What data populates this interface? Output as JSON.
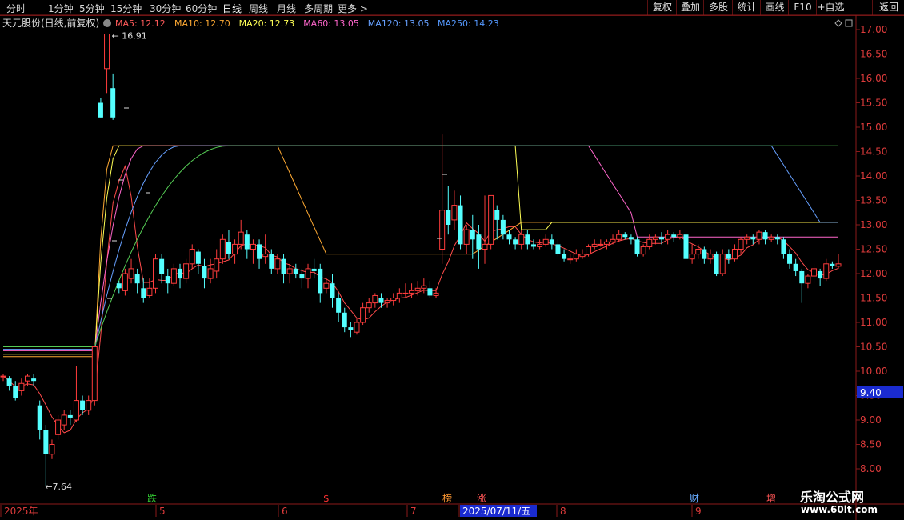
{
  "toolbar": {
    "tabs": [
      "分时",
      "1分钟",
      "5分钟",
      "15分钟",
      "30分钟",
      "60分钟",
      "日线",
      "周线",
      "月线",
      "多周期",
      "更多 >"
    ],
    "active_tab": "日线",
    "buttons": [
      "复权",
      "叠加",
      "多股",
      "统计",
      "画线",
      "F10",
      "+自选",
      "返回"
    ]
  },
  "legend": {
    "stock": "天元股份(日线,前复权)",
    "items": [
      {
        "text": "MA5: 12.12",
        "color": "#ff5a5a"
      },
      {
        "text": "MA10: 12.70",
        "color": "#ffaa33"
      },
      {
        "text": "MA20: 12.73",
        "color": "#ffff55"
      },
      {
        "text": "MA60: 13.05",
        "color": "#ff66cc"
      },
      {
        "text": "MA120: 13.05",
        "color": "#66a0ff"
      },
      {
        "text": "MA250: 14.23",
        "color": "#5599ff"
      }
    ]
  },
  "markers": [
    {
      "text": "跌",
      "color": "#33cc33"
    },
    {
      "text": "$",
      "color": "#ff3333"
    },
    {
      "text": "榜",
      "color": "#ff9933"
    },
    {
      "text": "涨",
      "color": "#ff5555"
    },
    {
      "text": "财",
      "color": "#66aaff"
    },
    {
      "text": "增",
      "color": "#ff5555"
    }
  ],
  "date_axis": [
    "2025年",
    "5",
    "6",
    "7",
    "2025/07/11/五",
    "8",
    "9"
  ],
  "price_tag": "9.40",
  "watermark": {
    "title": "乐淘公式网",
    "url": "www.60lt.com"
  },
  "colors": {
    "up": "#ff3c3c",
    "down": "#54ffff",
    "axis": "#8b1a1a",
    "bg": "#000000"
  },
  "chart_data": {
    "type": "candlestick",
    "ylim": [
      7.8,
      17.2
    ],
    "yticks": [
      8.0,
      8.5,
      9.0,
      9.5,
      10.0,
      10.5,
      11.0,
      11.5,
      12.0,
      12.5,
      13.0,
      13.5,
      14.0,
      14.5,
      15.0,
      15.5,
      16.0,
      16.5,
      17.0
    ],
    "high_label": "16.91",
    "low_label": "7.64",
    "candles": [
      [
        9.9,
        9.9,
        9.8,
        9.95
      ],
      [
        9.85,
        9.7,
        9.6,
        9.9
      ],
      [
        9.7,
        9.45,
        9.4,
        9.8
      ],
      [
        9.6,
        9.75,
        9.5,
        9.85
      ],
      [
        9.8,
        9.9,
        9.7,
        9.95
      ],
      [
        9.85,
        9.8,
        9.7,
        9.95
      ],
      [
        9.3,
        8.8,
        8.6,
        9.4
      ],
      [
        8.8,
        8.3,
        7.64,
        8.9
      ],
      [
        8.3,
        8.5,
        8.2,
        8.6
      ],
      [
        8.7,
        9.0,
        8.6,
        9.1
      ],
      [
        8.9,
        9.1,
        8.8,
        9.2
      ],
      [
        9.1,
        9.05,
        8.9,
        9.2
      ],
      [
        9.0,
        9.4,
        8.95,
        10.1
      ],
      [
        9.4,
        9.2,
        9.1,
        9.5
      ],
      [
        9.2,
        9.4,
        9.1,
        9.5
      ],
      [
        9.4,
        10.5,
        9.3,
        10.5
      ],
      [
        15.5,
        15.2,
        15.2,
        15.6
      ],
      [
        16.2,
        16.91,
        15.7,
        16.91
      ],
      [
        15.8,
        15.2,
        15.15,
        16.1
      ],
      [
        11.8,
        11.7,
        11.6,
        11.85
      ],
      [
        11.65,
        12.0,
        11.55,
        12.1
      ],
      [
        11.9,
        12.1,
        11.8,
        12.3
      ],
      [
        12.0,
        11.8,
        11.6,
        12.1
      ],
      [
        11.7,
        11.5,
        11.4,
        11.9
      ],
      [
        11.55,
        11.7,
        11.5,
        11.9
      ],
      [
        11.7,
        12.3,
        11.6,
        12.4
      ],
      [
        12.3,
        12.0,
        11.8,
        12.4
      ],
      [
        11.95,
        11.8,
        11.6,
        12.1
      ],
      [
        11.8,
        12.1,
        11.75,
        12.2
      ],
      [
        12.1,
        11.9,
        11.7,
        12.2
      ],
      [
        11.9,
        12.2,
        11.8,
        12.3
      ],
      [
        12.2,
        12.5,
        12.1,
        12.6
      ],
      [
        12.45,
        12.2,
        12.0,
        12.5
      ],
      [
        12.15,
        11.9,
        11.7,
        12.3
      ],
      [
        11.9,
        12.1,
        11.8,
        12.3
      ],
      [
        12.05,
        12.3,
        11.9,
        12.5
      ],
      [
        12.3,
        12.7,
        12.2,
        12.8
      ],
      [
        12.65,
        12.4,
        12.3,
        12.9
      ],
      [
        12.4,
        12.6,
        12.2,
        12.7
      ],
      [
        12.6,
        12.85,
        12.5,
        13.1
      ],
      [
        12.8,
        12.5,
        12.3,
        12.9
      ],
      [
        12.5,
        12.6,
        12.2,
        12.7
      ],
      [
        12.6,
        12.3,
        12.1,
        12.7
      ],
      [
        12.35,
        12.4,
        12.2,
        12.8
      ],
      [
        12.4,
        12.1,
        12.0,
        12.5
      ],
      [
        12.1,
        12.3,
        12.0,
        12.4
      ],
      [
        12.3,
        12.0,
        11.8,
        12.4
      ],
      [
        12.0,
        12.1,
        11.8,
        12.2
      ],
      [
        12.1,
        12.0,
        11.9,
        12.2
      ],
      [
        12.0,
        11.9,
        11.7,
        12.1
      ],
      [
        11.9,
        12.1,
        11.7,
        12.2
      ],
      [
        12.1,
        12.05,
        11.9,
        12.3
      ],
      [
        12.1,
        11.6,
        11.4,
        12.2
      ],
      [
        11.7,
        11.8,
        11.6,
        11.9
      ],
      [
        11.8,
        11.5,
        11.3,
        12.0
      ],
      [
        11.5,
        11.2,
        11.0,
        11.6
      ],
      [
        11.2,
        10.9,
        10.8,
        11.3
      ],
      [
        10.9,
        10.85,
        10.7,
        11.0
      ],
      [
        10.8,
        11.0,
        10.75,
        11.1
      ],
      [
        11.0,
        11.3,
        10.95,
        11.4
      ],
      [
        11.3,
        11.4,
        11.2,
        11.5
      ],
      [
        11.4,
        11.55,
        11.3,
        11.6
      ],
      [
        11.5,
        11.4,
        11.3,
        11.6
      ],
      [
        11.4,
        11.45,
        11.3,
        11.5
      ],
      [
        11.45,
        11.5,
        11.35,
        11.6
      ],
      [
        11.5,
        11.6,
        11.4,
        11.7
      ],
      [
        11.6,
        11.6,
        11.5,
        11.8
      ],
      [
        11.6,
        11.65,
        11.5,
        11.8
      ],
      [
        11.65,
        11.7,
        11.55,
        11.85
      ],
      [
        11.7,
        11.75,
        11.6,
        11.9
      ],
      [
        11.7,
        11.55,
        11.5,
        11.85
      ],
      [
        11.55,
        11.6,
        11.5,
        11.7
      ],
      [
        12.5,
        13.3,
        12.2,
        14.85
      ],
      [
        13.3,
        13.0,
        12.8,
        13.8
      ],
      [
        13.1,
        13.4,
        12.9,
        13.7
      ],
      [
        13.4,
        12.6,
        12.5,
        13.6
      ],
      [
        12.6,
        12.9,
        12.4,
        13.0
      ],
      [
        12.9,
        12.7,
        12.3,
        13.2
      ],
      [
        12.8,
        12.5,
        12.1,
        13.0
      ],
      [
        12.5,
        12.6,
        12.2,
        13.6
      ],
      [
        12.6,
        13.6,
        12.5,
        13.6
      ],
      [
        13.3,
        13.1,
        12.7,
        13.4
      ],
      [
        13.1,
        12.8,
        12.7,
        13.2
      ],
      [
        12.8,
        12.7,
        12.6,
        12.9
      ],
      [
        12.7,
        12.6,
        12.5,
        12.75
      ],
      [
        12.6,
        12.8,
        12.5,
        12.9
      ],
      [
        12.8,
        12.6,
        12.5,
        12.9
      ],
      [
        12.6,
        12.55,
        12.5,
        12.7
      ],
      [
        12.55,
        12.6,
        12.5,
        12.7
      ],
      [
        12.6,
        12.7,
        12.55,
        12.8
      ],
      [
        12.7,
        12.6,
        12.5,
        12.8
      ],
      [
        12.6,
        12.4,
        12.35,
        12.7
      ],
      [
        12.4,
        12.3,
        12.25,
        12.5
      ],
      [
        12.3,
        12.3,
        12.2,
        12.4
      ],
      [
        12.3,
        12.4,
        12.25,
        12.5
      ],
      [
        12.35,
        12.4,
        12.3,
        12.5
      ],
      [
        12.4,
        12.55,
        12.35,
        12.6
      ],
      [
        12.55,
        12.6,
        12.5,
        12.7
      ],
      [
        12.6,
        12.6,
        12.55,
        12.7
      ],
      [
        12.6,
        12.65,
        12.5,
        12.7
      ],
      [
        12.65,
        12.7,
        12.6,
        12.8
      ],
      [
        12.7,
        12.8,
        12.65,
        12.9
      ],
      [
        12.8,
        12.75,
        12.7,
        12.85
      ],
      [
        12.75,
        12.7,
        12.6,
        12.8
      ],
      [
        12.7,
        12.4,
        12.35,
        12.75
      ],
      [
        12.4,
        12.55,
        12.35,
        12.6
      ],
      [
        12.55,
        12.7,
        12.5,
        12.8
      ],
      [
        12.7,
        12.75,
        12.6,
        12.8
      ],
      [
        12.75,
        12.7,
        12.6,
        12.85
      ],
      [
        12.7,
        12.8,
        12.6,
        12.9
      ],
      [
        12.8,
        12.75,
        12.65,
        12.85
      ],
      [
        12.75,
        12.8,
        12.7,
        12.9
      ],
      [
        12.8,
        12.3,
        11.8,
        12.85
      ],
      [
        12.3,
        12.4,
        12.2,
        12.6
      ],
      [
        12.4,
        12.5,
        12.3,
        12.6
      ],
      [
        12.5,
        12.3,
        12.2,
        12.55
      ],
      [
        12.3,
        12.4,
        12.2,
        12.5
      ],
      [
        12.4,
        12.0,
        11.95,
        12.45
      ],
      [
        12.0,
        12.4,
        11.95,
        12.5
      ],
      [
        12.4,
        12.3,
        12.2,
        12.5
      ],
      [
        12.3,
        12.5,
        12.25,
        12.6
      ],
      [
        12.5,
        12.7,
        12.4,
        12.75
      ],
      [
        12.7,
        12.75,
        12.6,
        12.8
      ],
      [
        12.75,
        12.7,
        12.6,
        12.8
      ],
      [
        12.7,
        12.85,
        12.6,
        12.9
      ],
      [
        12.85,
        12.7,
        12.6,
        12.9
      ],
      [
        12.7,
        12.75,
        12.65,
        12.8
      ],
      [
        12.75,
        12.7,
        12.6,
        12.8
      ],
      [
        12.7,
        12.4,
        12.3,
        12.75
      ],
      [
        12.4,
        12.2,
        12.1,
        12.5
      ],
      [
        12.2,
        12.05,
        11.95,
        12.3
      ],
      [
        12.05,
        11.8,
        11.4,
        12.1
      ],
      [
        11.8,
        11.95,
        11.7,
        12.0
      ],
      [
        11.95,
        12.1,
        11.8,
        12.2
      ],
      [
        12.05,
        11.9,
        11.75,
        12.1
      ],
      [
        11.9,
        12.2,
        11.85,
        12.3
      ],
      [
        12.2,
        12.15,
        12.1,
        12.25
      ],
      [
        12.15,
        12.2,
        12.1,
        12.4
      ]
    ],
    "ma_current": {
      "MA5": 12.12,
      "MA10": 12.7,
      "MA20": 12.73,
      "MA60": 13.05,
      "MA120": 13.05,
      "MA250": 14.23
    }
  }
}
